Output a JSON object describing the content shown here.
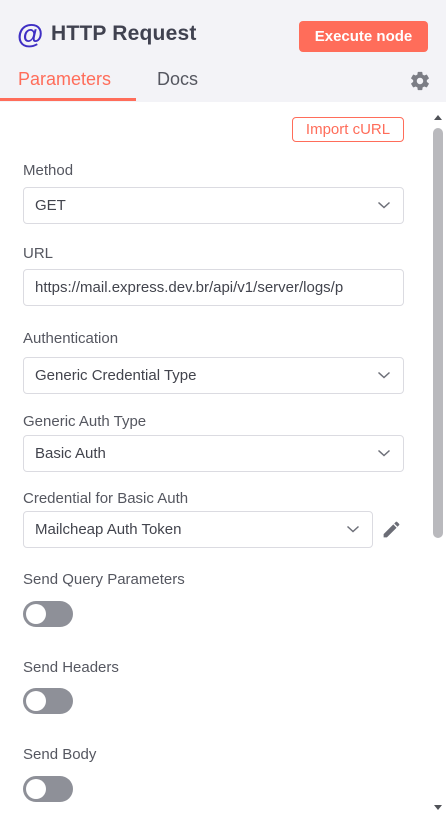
{
  "header": {
    "icon": "at-sign-icon",
    "title": "HTTP Request",
    "execute_label": "Execute node",
    "accent": "#ff6d5a",
    "icon_color": "#3f2fc4"
  },
  "tabs": [
    {
      "label": "Parameters",
      "active": true
    },
    {
      "label": "Docs",
      "active": false
    }
  ],
  "settings_icon": "gear-icon",
  "import_label": "Import cURL",
  "fields": {
    "method": {
      "label": "Method",
      "value": "GET"
    },
    "url": {
      "label": "URL",
      "value": "https://mail.express.dev.br/api/v1/server/logs/p"
    },
    "authentication": {
      "label": "Authentication",
      "value": "Generic Credential Type"
    },
    "generic_auth_type": {
      "label": "Generic Auth Type",
      "value": "Basic Auth"
    },
    "credential": {
      "label": "Credential for Basic Auth",
      "value": "Mailcheap Auth Token"
    }
  },
  "toggles": {
    "send_query": {
      "label": "Send Query Parameters",
      "on": false
    },
    "send_headers": {
      "label": "Send Headers",
      "on": false
    },
    "send_body": {
      "label": "Send Body",
      "on": false
    }
  }
}
